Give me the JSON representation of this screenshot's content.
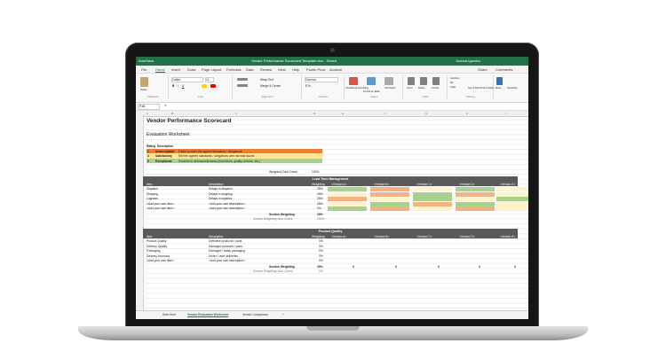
{
  "window": {
    "autosave": "AutoSave",
    "title": "Vendor Performance Scorecard Template.xlsx - Saved",
    "user": "Joanna Igwuiko"
  },
  "menu": [
    "File",
    "Home",
    "Insert",
    "Draw",
    "Page Layout",
    "Formulas",
    "Data",
    "Review",
    "View",
    "Help",
    "Power Pivot",
    "Acrobat"
  ],
  "share": {
    "share": "Share",
    "comments": "Comments"
  },
  "ribbon": {
    "paste": "Paste",
    "clipboard": "Clipboard",
    "font_name": "Calibri",
    "font_size": "11",
    "font": "Font",
    "alignment": "Alignment",
    "wrap_text": "Wrap Text",
    "merge": "Merge & Center",
    "number_format": "General",
    "number": "Number",
    "conditional": "Conditional Formatting",
    "format_table": "Format as Table",
    "cell_styles": "Cell Styles",
    "styles": "Styles",
    "insert": "Insert",
    "delete": "Delete",
    "format": "Format",
    "cells": "Cells",
    "autosum": "AutoSum",
    "fill": "Fill",
    "clear": "Clear",
    "sort": "Sort & Filter",
    "find": "Find & Select",
    "editing": "Editing",
    "ideas": "Ideas",
    "sensitivity": "Sensitivity"
  },
  "namebox": "F16",
  "fx": "fx",
  "columns": [
    "A",
    "B",
    "C",
    "D",
    "E",
    "F",
    "G",
    "H",
    "I"
  ],
  "sheet": {
    "title": "Vendor Performance Scorecard",
    "subtitle": "Evaluation Worksheet",
    "rating_hdr": "Rating",
    "desc_hdr": "Description",
    "ratings": [
      {
        "n": "1",
        "name": "Unacceptable",
        "desc": "Failed to meet the agreed standards / obligations"
      },
      {
        "n": "3",
        "name": "Satisfactory",
        "desc": "Met the agreed standards / obligations with minimal issues"
      },
      {
        "n": "5",
        "name": "Exceptional",
        "desc": "Exceeds in all essential areas (lead times, quality, service, etc.)"
      }
    ],
    "weighted_check": "Weighted Total Check",
    "weighted_check_val": "100%",
    "section1": "Lead Time Management",
    "section2": "Product Quality",
    "item_hdr": "Item",
    "description_hdr": "Description",
    "weighting_hdr": "Weighting",
    "vendors": [
      "<Vendor A>",
      "<Vendor B>",
      "<Vendor C>",
      "<Vendor D>",
      "<Vendor E>"
    ],
    "rows1": [
      {
        "item": "Dispatch",
        "desc": "Delays in dispatch",
        "w": "25%"
      },
      {
        "item": "Shipping",
        "desc": "Delays in shipping",
        "w": "25%"
      },
      {
        "item": "Logistics",
        "desc": "Delays in logistics",
        "w": "25%"
      },
      {
        "item": "<Add your own item>",
        "desc": "<Add your own description>",
        "w": "25%"
      },
      {
        "item": "<Add your own item>",
        "desc": "<Add your own description>",
        "w": "0%"
      }
    ],
    "rows2": [
      {
        "item": "Product Quality",
        "desc": "Defective products / parts",
        "w": "0%"
      },
      {
        "item": "Delivery Quality",
        "desc": "Damaged products / parts",
        "w": "0%"
      },
      {
        "item": "Packaging",
        "desc": "Damaged / faulty packaging",
        "w": "0%"
      },
      {
        "item": "Delivery Accuracy",
        "desc": "Under / over deliveries",
        "w": "0%"
      },
      {
        "item": "<Add your own item>",
        "desc": "<Add your own description>",
        "w": "0%"
      }
    ],
    "section_weighting": "Section Weighting",
    "sum_check": "Section Weighting Sum Check",
    "sw1": "20%",
    "sw2": "20%",
    "sum1": "100%",
    "sum2": "0%",
    "zero": "0"
  },
  "tabs": [
    "Start Here",
    "Vendor Evaluation Worksheet",
    "Vendor Comparison",
    "+"
  ],
  "colors": {
    "excel_green": "#217346",
    "orange": "#f4b183",
    "red_orange": "#ed7d31",
    "yellow": "#ffe699",
    "green": "#a9d18e",
    "lightyellow": "#fff2cc"
  }
}
